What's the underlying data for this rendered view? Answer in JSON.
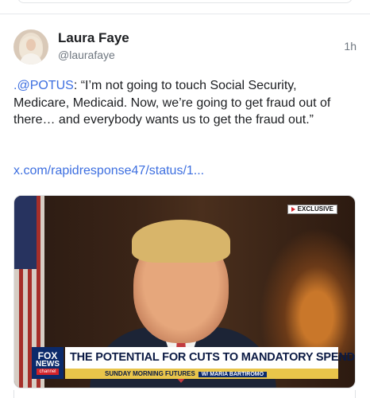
{
  "post": {
    "author_name": "Laura Faye",
    "author_handle": "@laurafaye",
    "time": "1h",
    "mention": ".@POTUS",
    "text_rest": ": “I’m not going to touch Social Security, Medicare, Medicaid. Now, we’re going to get fraud out of there… and everybody wants us to get the fraud out.”",
    "link": "x.com/rapidresponse47/status/1..."
  },
  "media": {
    "exclusive_label": "EXCLUSIVE",
    "logo_line1": "FOX",
    "logo_line2": "NEWS",
    "logo_line3": "channel",
    "headline": "THE POTENTIAL FOR CUTS TO MANDATORY SPENDING",
    "subline": "SUNDAY MORNING FUTURES",
    "subline_tag": "W/ MARIA BARTIROMO"
  }
}
